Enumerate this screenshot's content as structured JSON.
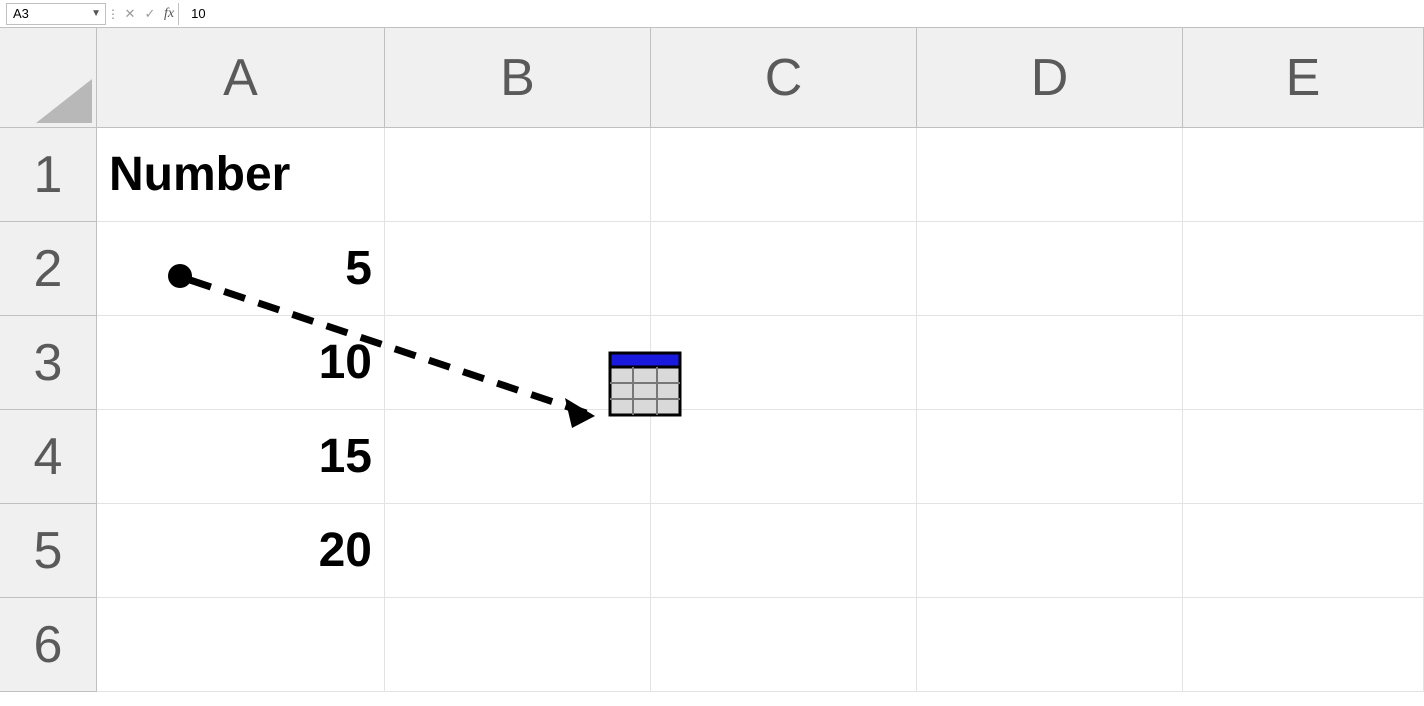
{
  "formula_bar": {
    "name_box_value": "A3",
    "cancel_symbol": "✕",
    "confirm_symbol": "✓",
    "fx_label": "fx",
    "formula_value": "10"
  },
  "columns": [
    "A",
    "B",
    "C",
    "D",
    "E"
  ],
  "rows": [
    "1",
    "2",
    "3",
    "4",
    "5",
    "6"
  ],
  "cells": {
    "A1": "Number",
    "A2": "5",
    "A3": "10",
    "A4": "15",
    "A5": "20"
  },
  "chart_data": {
    "type": "table",
    "title": "",
    "columns": [
      "Number"
    ],
    "rows": [
      [
        5
      ],
      [
        10
      ],
      [
        15
      ],
      [
        20
      ]
    ]
  }
}
